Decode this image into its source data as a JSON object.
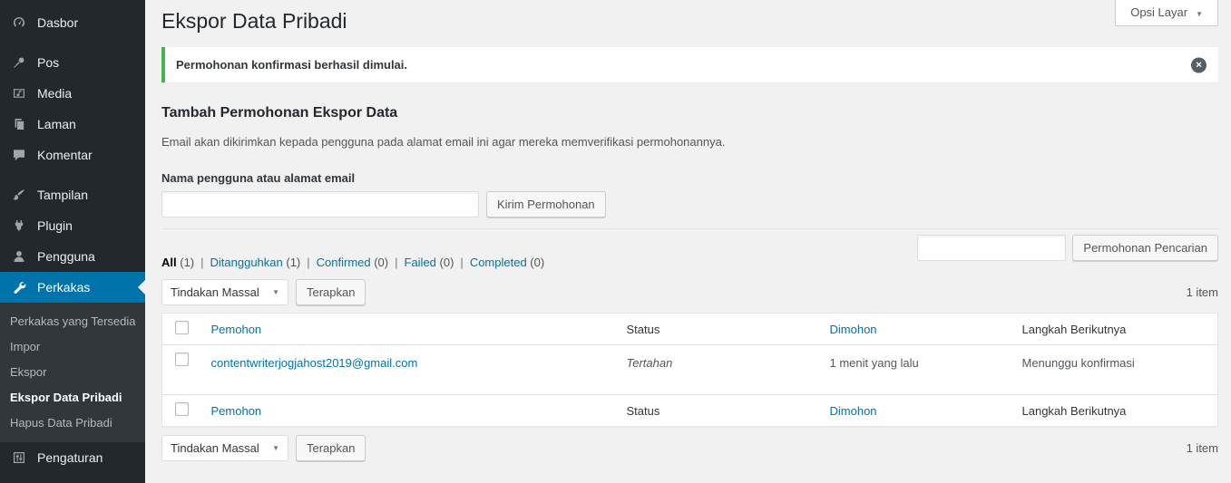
{
  "colors": {
    "accent": "#0073aa",
    "success_green": "#46b450",
    "sidebar_bg": "#23282d",
    "submenu_bg": "#32373c",
    "link": "#0073aa"
  },
  "sidebar": {
    "items": [
      {
        "label": "Dasbor",
        "icon": "dashboard-icon"
      },
      {
        "separator": true
      },
      {
        "label": "Pos",
        "icon": "pin-icon"
      },
      {
        "label": "Media",
        "icon": "media-icon"
      },
      {
        "label": "Laman",
        "icon": "pages-icon"
      },
      {
        "label": "Komentar",
        "icon": "comment-icon"
      },
      {
        "separator": true
      },
      {
        "label": "Tampilan",
        "icon": "brush-icon"
      },
      {
        "label": "Plugin",
        "icon": "plugin-icon"
      },
      {
        "label": "Pengguna",
        "icon": "user-icon"
      },
      {
        "label": "Perkakas",
        "icon": "wrench-icon",
        "active": true,
        "submenu": [
          {
            "label": "Perkakas yang Tersedia"
          },
          {
            "label": "Impor"
          },
          {
            "label": "Ekspor"
          },
          {
            "label": "Ekspor Data Pribadi",
            "current": true
          },
          {
            "label": "Hapus Data Pribadi"
          }
        ]
      },
      {
        "label": "Pengaturan",
        "icon": "settings-icon"
      }
    ]
  },
  "header": {
    "title": "Ekspor Data Pribadi",
    "screen_options_label": "Opsi Layar",
    "screen_options_icon": "chevron-down-icon"
  },
  "notice": {
    "message": "Permohonan konfirmasi berhasil dimulai.",
    "dismiss_icon": "circled-x-icon",
    "dismiss_glyph": "✕"
  },
  "form": {
    "heading": "Tambah Permohonan Ekspor Data",
    "description": "Email akan dikirimkan kepada pengguna pada alamat email ini agar mereka memverifikasi permohonannya.",
    "label": "Nama pengguna atau alamat email",
    "input_value": "",
    "submit_label": "Kirim Permohonan"
  },
  "filters": [
    {
      "label": "All",
      "count": "(1)",
      "current": true
    },
    {
      "label": "Ditangguhkan",
      "count": "(1)"
    },
    {
      "label": "Confirmed",
      "count": "(0)"
    },
    {
      "label": "Failed",
      "count": "(0)"
    },
    {
      "label": "Completed",
      "count": "(0)"
    }
  ],
  "search": {
    "input_value": "",
    "button_label": "Permohonan Pencarian"
  },
  "bulk": {
    "select_value": "Tindakan Massal",
    "select_icon": "chevron-down-icon",
    "apply_label": "Terapkan"
  },
  "list": {
    "count_text": "1 item"
  },
  "table": {
    "columns": [
      {
        "label": "Pemohon",
        "link": true
      },
      {
        "label": "Status",
        "link": false
      },
      {
        "label": "Dimohon",
        "link": true
      },
      {
        "label": "Langkah Berikutnya",
        "link": false
      }
    ],
    "rows": [
      {
        "requester": "contentwriterjogjahost2019@gmail.com",
        "status": "Tertahan",
        "requested": "1 menit yang lalu",
        "next_step": "Menunggu konfirmasi"
      }
    ]
  }
}
